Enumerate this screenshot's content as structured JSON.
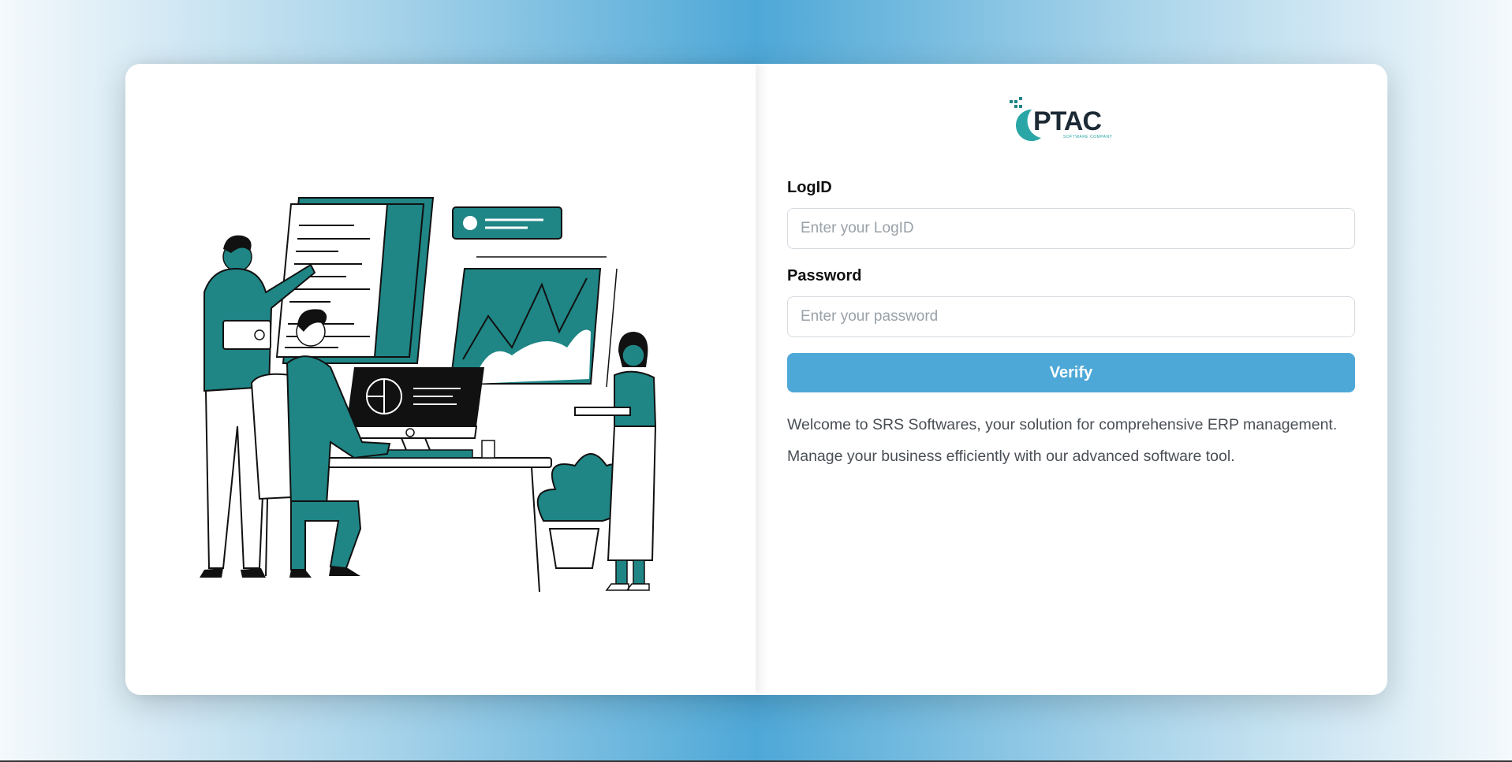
{
  "logo": {
    "brand": "PTAC",
    "tagline": "SOFTWARE COMPANY"
  },
  "form": {
    "logid_label": "LogID",
    "logid_placeholder": "Enter your LogID",
    "password_label": "Password",
    "password_placeholder": "Enter your password",
    "verify_label": "Verify"
  },
  "welcome": {
    "line1": "Welcome to SRS Softwares, your solution for comprehensive ERP management.",
    "line2": "Manage your business efficiently with our advanced software tool."
  },
  "colors": {
    "accent": "#4ea8d7",
    "illustration_teal": "#1f8585"
  }
}
